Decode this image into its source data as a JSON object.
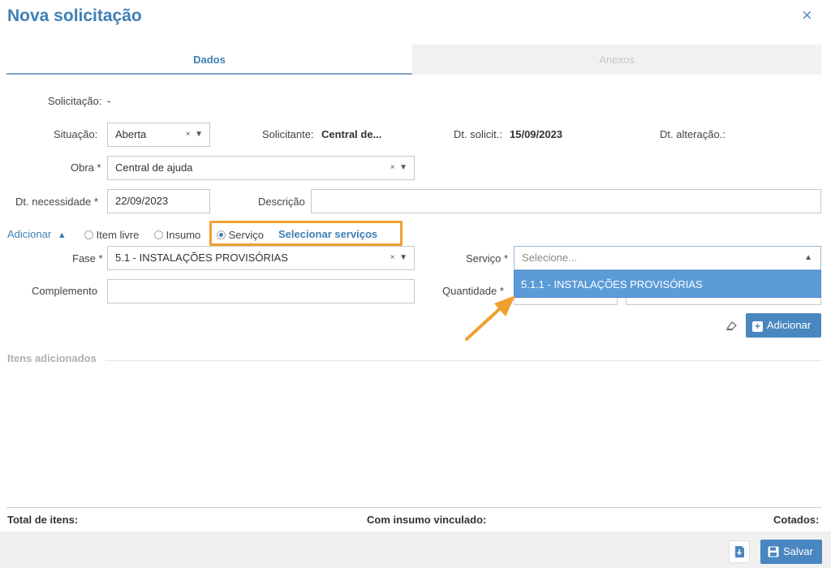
{
  "modal": {
    "title": "Nova solicitação",
    "close_icon": "×"
  },
  "tabs": [
    {
      "label": "Dados",
      "active": true
    },
    {
      "label": "Anexos",
      "active": false
    }
  ],
  "form": {
    "solicitacao_label": "Solicitação:",
    "solicitacao_value": "-",
    "situacao_label": "Situação:",
    "situacao_value": "Aberta",
    "solicitante_label": "Solicitante:",
    "solicitante_value": "Central de...",
    "dt_solicit_label": "Dt. solicit.:",
    "dt_solicit_value": "15/09/2023",
    "dt_alteracao_label": "Dt. alteração.:",
    "obra_label": "Obra *",
    "obra_value": "Central de ajuda",
    "dt_necessidade_label": "Dt. necessidade *",
    "dt_necessidade_value": "22/09/2023",
    "descricao_label": "Descrição",
    "descricao_value": ""
  },
  "adicionar": {
    "label": "Adicionar",
    "options": [
      {
        "label": "Item livre",
        "selected": false
      },
      {
        "label": "Insumo",
        "selected": false
      },
      {
        "label": "Serviço",
        "selected": true
      }
    ],
    "select_link": "Selecionar serviços",
    "fase_label": "Fase *",
    "fase_value": "5.1 - INSTALAÇÕES PROVISÓRIAS",
    "servico_label": "Serviço *",
    "servico_placeholder": "Selecione...",
    "dropdown_option": "5.1.1 - INSTALAÇÕES PROVISÓRIAS",
    "complemento_label": "Complemento",
    "complemento_value": "",
    "quantidade_label": "Quantidade *",
    "add_button": "Adicionar"
  },
  "itens": {
    "section_label": "Itens adicionados"
  },
  "footer": {
    "total_itens": "Total de itens:",
    "com_insumo": "Com insumo vinculado:",
    "cotados": "Cotados:",
    "save_button": "Salvar"
  },
  "colors": {
    "accent": "#3f7fb5",
    "highlight": "#f0a030",
    "dropdown_bg": "#5b9bd8",
    "button_bg": "#4a86c0"
  }
}
